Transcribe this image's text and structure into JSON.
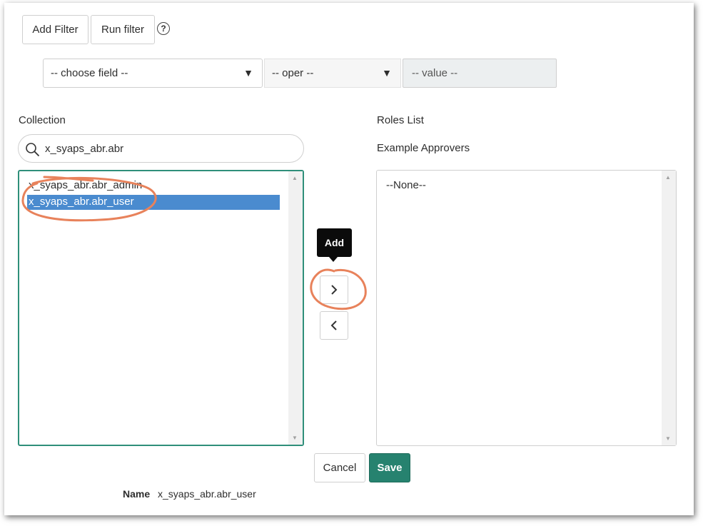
{
  "toolbar": {
    "add_filter_label": "Add Filter",
    "run_filter_label": "Run filter",
    "help_icon": "question-circle-icon",
    "help_glyph": "?"
  },
  "filter": {
    "field_select": "-- choose field --",
    "oper_select": "-- oper --",
    "value_field": "-- value --",
    "arrow_glyph": "▼"
  },
  "collection": {
    "label": "Collection",
    "search_value": "x_syaps_abr.abr",
    "search_icon": "magnifier-icon",
    "items": [
      "x_syaps_abr.abr_admin",
      "x_syaps_abr.abr_user"
    ],
    "selected_index": 1
  },
  "roles": {
    "label": "Roles List",
    "sublabel": "Example Approvers",
    "items": [
      "--None--"
    ]
  },
  "move": {
    "add_tooltip": "Add",
    "add_glyph": "›",
    "remove_glyph": "‹"
  },
  "actions": {
    "cancel_label": "Cancel",
    "save_label": "Save"
  },
  "name_row": {
    "label": "Name",
    "value": "x_syaps_abr.abr_user"
  },
  "colors": {
    "selected_bg": "#4a8bcf",
    "save_bg": "#26826f",
    "focus_border": "#2f8f7a",
    "annotation": "#e8825b"
  }
}
